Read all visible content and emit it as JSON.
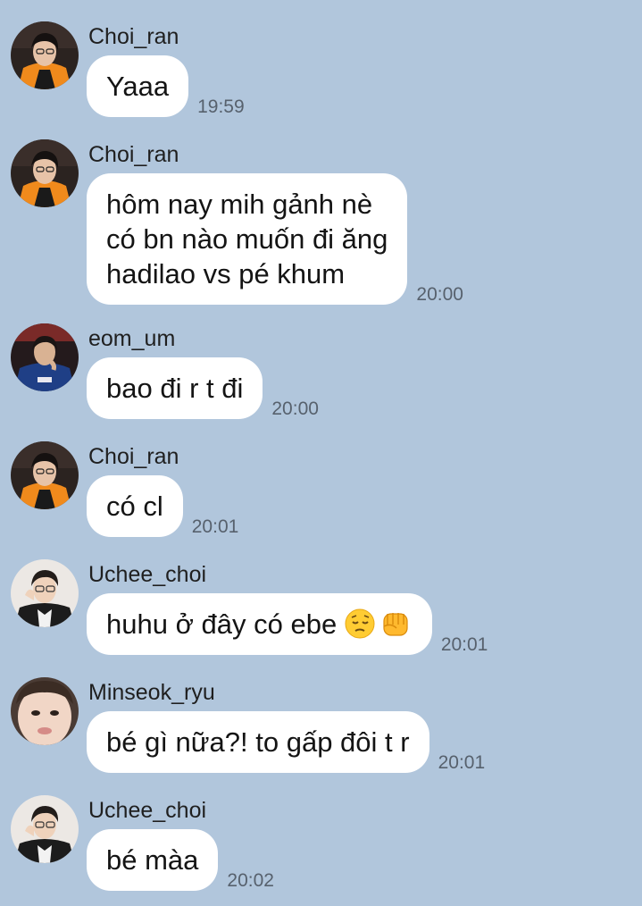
{
  "messages": [
    {
      "sender": "Choi_ran",
      "avatar_icon": "choi-ran-avatar",
      "text": "Yaaa",
      "time": "19:59"
    },
    {
      "sender": "Choi_ran",
      "avatar_icon": "choi-ran-avatar",
      "text": "hôm nay mih gảnh nè\ncó bn nào muốn đi ăng\nhadilao vs pé khum",
      "time": "20:00"
    },
    {
      "sender": "eom_um",
      "avatar_icon": "eom-um-avatar",
      "text": "bao đi r t đi",
      "time": "20:00"
    },
    {
      "sender": "Choi_ran",
      "avatar_icon": "choi-ran-avatar",
      "text": "có cl",
      "time": "20:01"
    },
    {
      "sender": "Uchee_choi",
      "avatar_icon": "uchee-choi-avatar",
      "text": "huhu ở đây có ebe ",
      "emojis": [
        "pensive-face-emoji",
        "fist-emoji"
      ],
      "time": "20:01"
    },
    {
      "sender": "Minseok_ryu",
      "avatar_icon": "minseok-ryu-avatar",
      "text": "bé gì nữa?! to gấp đôi t r",
      "time": "20:01"
    },
    {
      "sender": "Uchee_choi",
      "avatar_icon": "uchee-choi-avatar",
      "text": "bé màa",
      "time": "20:02"
    }
  ],
  "colors": {
    "background": "#b1c6dc",
    "bubble": "#ffffff",
    "text": "#141414",
    "time": "#57616d"
  }
}
